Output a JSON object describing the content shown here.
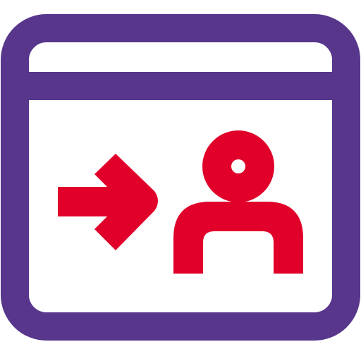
{
  "icon": {
    "name": "browser-login-user-icon",
    "colors": {
      "frame": "#57368C",
      "accent": "#E0002A",
      "background": "#FFFFFF"
    },
    "parts": [
      "browser-window-icon",
      "arrow-right-icon",
      "user-icon"
    ]
  }
}
